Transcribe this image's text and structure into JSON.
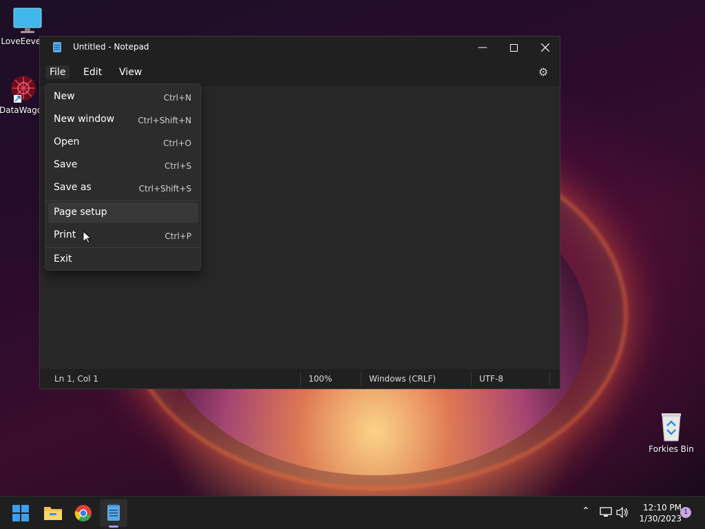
{
  "desktop": {
    "icons": [
      {
        "label": "LoveEeve PC"
      },
      {
        "label": "DataWago"
      },
      {
        "label": "Forkies Bin"
      }
    ]
  },
  "window": {
    "title": "Untitled - Notepad",
    "menus": [
      "File",
      "Edit",
      "View"
    ],
    "status": {
      "position": "Ln 1, Col 1",
      "zoom": "100%",
      "line_endings": "Windows (CRLF)",
      "encoding": "UTF-8"
    }
  },
  "file_menu": {
    "items": [
      {
        "label": "New",
        "shortcut": "Ctrl+N"
      },
      {
        "label": "New window",
        "shortcut": "Ctrl+Shift+N"
      },
      {
        "label": "Open",
        "shortcut": "Ctrl+O"
      },
      {
        "label": "Save",
        "shortcut": "Ctrl+S"
      },
      {
        "label": "Save as",
        "shortcut": "Ctrl+Shift+S"
      },
      {
        "label": "Page setup",
        "shortcut": ""
      },
      {
        "label": "Print",
        "shortcut": "Ctrl+P"
      },
      {
        "label": "Exit",
        "shortcut": ""
      }
    ]
  },
  "taskbar": {
    "clock_time": "12:10 PM",
    "clock_date": "1/30/2023",
    "notification_count": "1"
  },
  "colors": {
    "accent": "#5aa9e6",
    "window_bg": "#272727",
    "titlebar_bg": "#202020"
  }
}
